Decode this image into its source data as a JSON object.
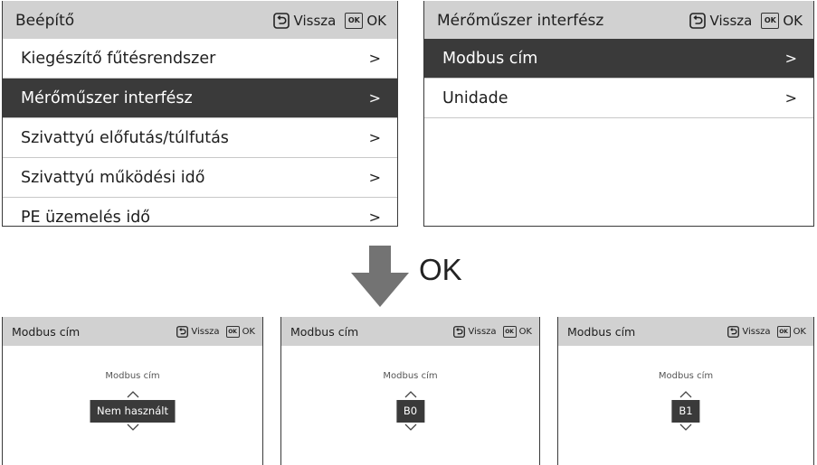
{
  "header_controls": {
    "back_label": "Vissza",
    "ok_label": "OK",
    "ok_icon_text": "OK"
  },
  "chevron": ">",
  "builder_panel": {
    "title": "Beépítő",
    "items": [
      {
        "label": "Kiegészítő fűtésrendszer",
        "selected": false
      },
      {
        "label": "Mérőműszer interfész",
        "selected": true
      },
      {
        "label": "Szivattyú előfutás/túlfutás",
        "selected": false
      },
      {
        "label": "Szivattyú működési idő",
        "selected": false
      },
      {
        "label": "PE üzemelés idő",
        "selected": false
      }
    ]
  },
  "meter_panel": {
    "title": "Mérőműszer interfész",
    "items": [
      {
        "label": "Modbus cím",
        "selected": true
      },
      {
        "label": "Unidade",
        "selected": false
      }
    ]
  },
  "transition": {
    "label": "OK"
  },
  "modbus_panels": [
    {
      "title": "Modbus cím",
      "field_label": "Modbus cím",
      "value": "Nem használt"
    },
    {
      "title": "Modbus cím",
      "field_label": "Modbus cím",
      "value": "B0"
    },
    {
      "title": "Modbus cím",
      "field_label": "Modbus cím",
      "value": "B1"
    }
  ],
  "colors": {
    "header_bg": "#d1d1d1",
    "selected_bg": "#3a3a3a",
    "arrow": "#737373"
  }
}
